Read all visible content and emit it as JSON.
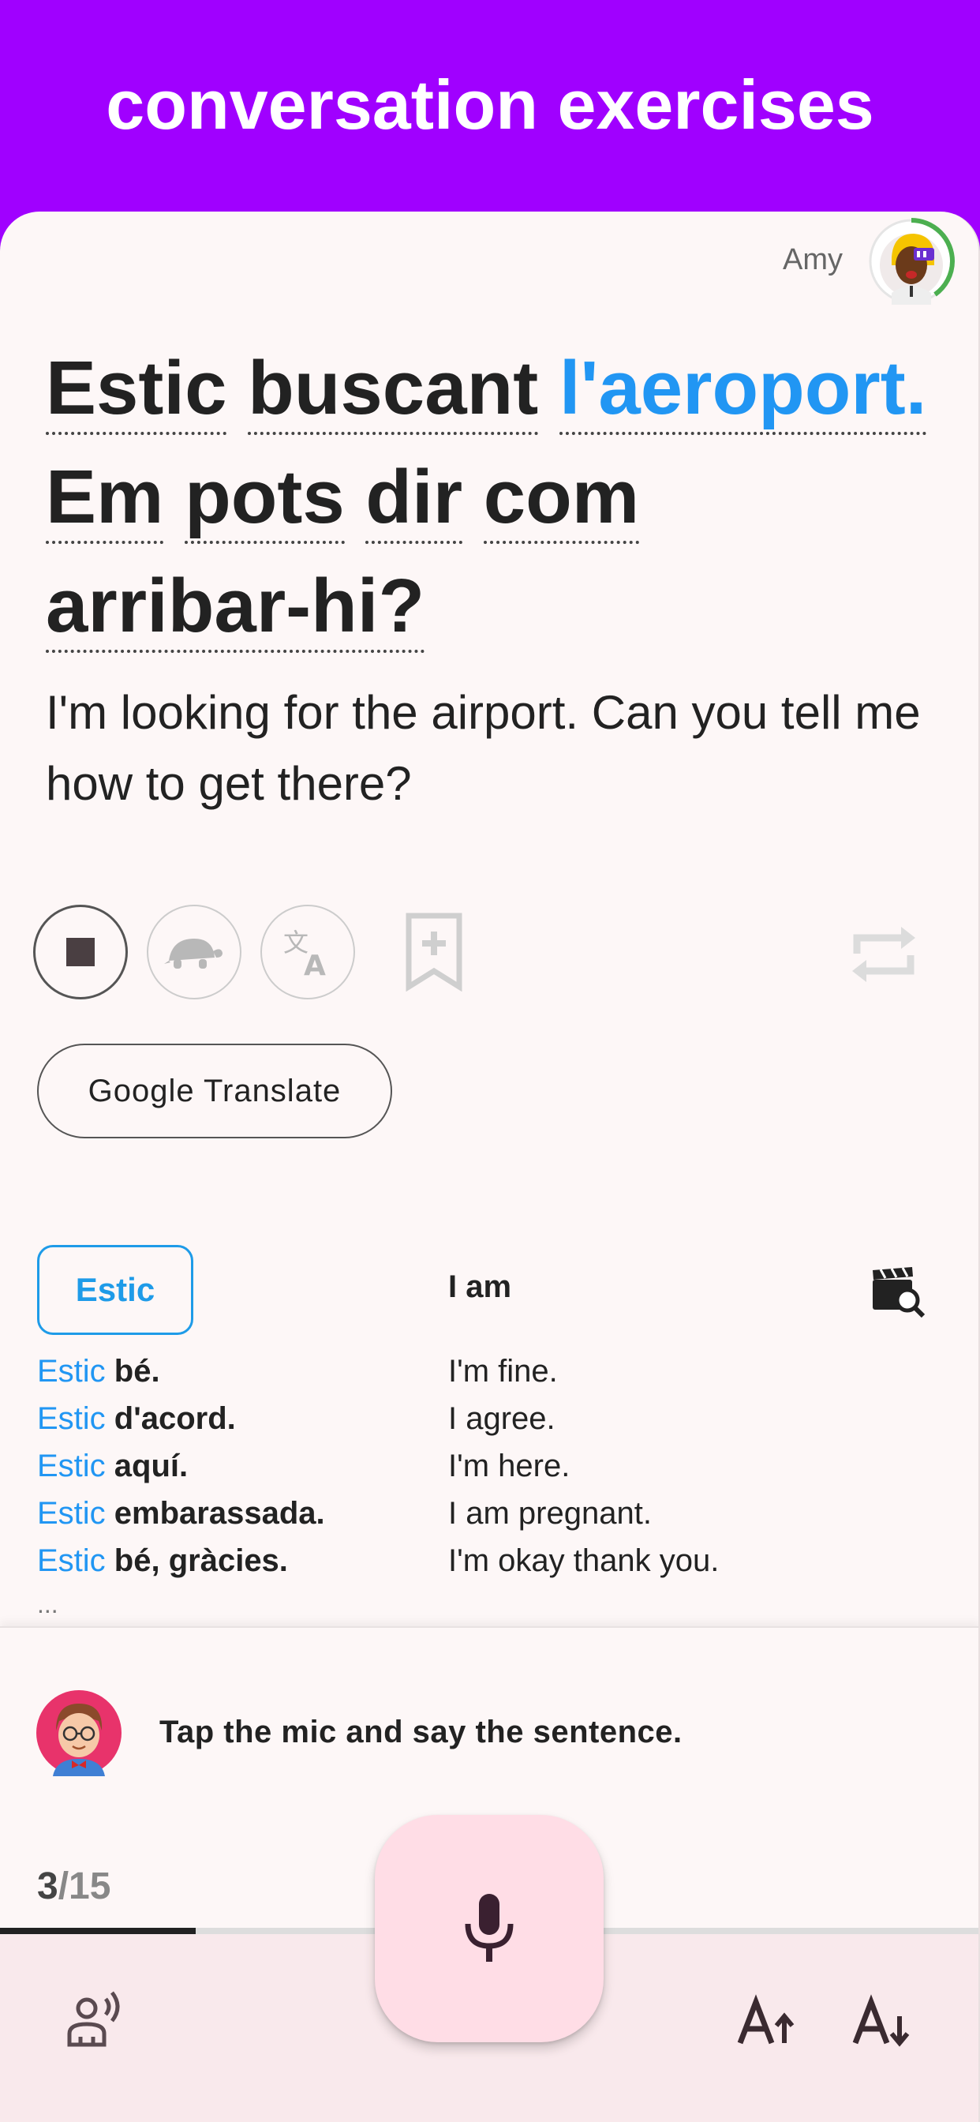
{
  "header": {
    "title": "conversation exercises"
  },
  "tutor": {
    "name": "Amy"
  },
  "sentence": {
    "words": [
      "Estic",
      "buscant",
      "l'aeroport.",
      "Em",
      "pots",
      "dir",
      "com",
      "arribar-hi?"
    ],
    "highlighted_word": "l'aeroport."
  },
  "translation": "I'm looking for the airport. Can you tell me how to get there?",
  "controls": {
    "stop_icon": "stop-icon",
    "slow_icon": "turtle-icon",
    "translate_icon": "translate-icon",
    "bookmark_icon": "bookmark-add-icon",
    "repeat_icon": "repeat-icon"
  },
  "google_translate_label": "Google Translate",
  "word_lookup": {
    "word": "Estic",
    "meaning": "I am",
    "examples": [
      {
        "keyword": "Estic",
        "rest": " bé.",
        "en": "I'm fine."
      },
      {
        "keyword": "Estic",
        "rest": " d'acord.",
        "en": "I agree."
      },
      {
        "keyword": "Estic",
        "rest": " aquí.",
        "en": "I'm here."
      },
      {
        "keyword": "Estic",
        "rest": " embarassada.",
        "en": "I am pregnant."
      },
      {
        "keyword": "Estic",
        "rest": " bé, gràcies.",
        "en": "I'm okay thank you."
      }
    ],
    "more": "..."
  },
  "coach": {
    "message": "Tap the mic and say the sentence."
  },
  "progress": {
    "current": "3",
    "total": "/15",
    "fraction": 0.2
  },
  "colors": {
    "header_bg": "#a000ff",
    "highlight_blue": "#2196f3",
    "mic_fab_bg": "#ffdde6",
    "toolbar_bg": "#f9e9ec"
  }
}
